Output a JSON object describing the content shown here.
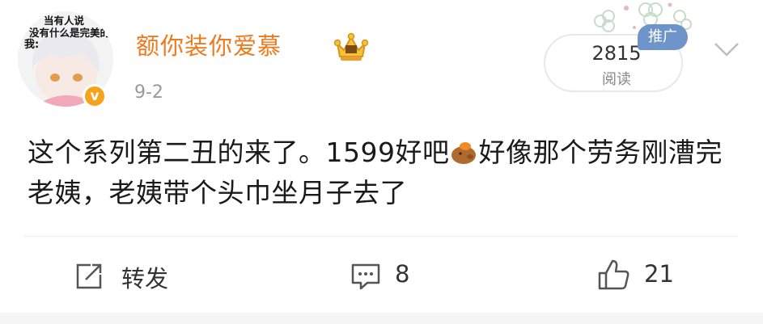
{
  "user": {
    "avatar_caption": [
      "当有人说",
      "没有什么是完美的",
      "我:"
    ],
    "name": "额你装你爱慕",
    "verified_mark": "v",
    "date": "9-2"
  },
  "stats": {
    "views_count": "2815",
    "views_label": "阅读",
    "promo_tag": "推广"
  },
  "post": {
    "text_before_emoji": "这个系列第二丑的来了。1599好吧",
    "text_after_emoji": "好像那个劳务刚漕完老姨，老姨带个头巾坐月子去了"
  },
  "actions": {
    "repost_label": "转发",
    "comment_count": "8",
    "like_count": "21"
  },
  "icons": [
    "medal-crown-icon",
    "clover-decoration-icon",
    "chevron-down-icon",
    "capybara-emoji-icon",
    "repost-icon",
    "comment-icon",
    "like-icon"
  ],
  "colors": {
    "username": "#ee7a1d",
    "verified": "#f7a21b",
    "promo_tag": "#6f94c9",
    "date": "#999999"
  }
}
